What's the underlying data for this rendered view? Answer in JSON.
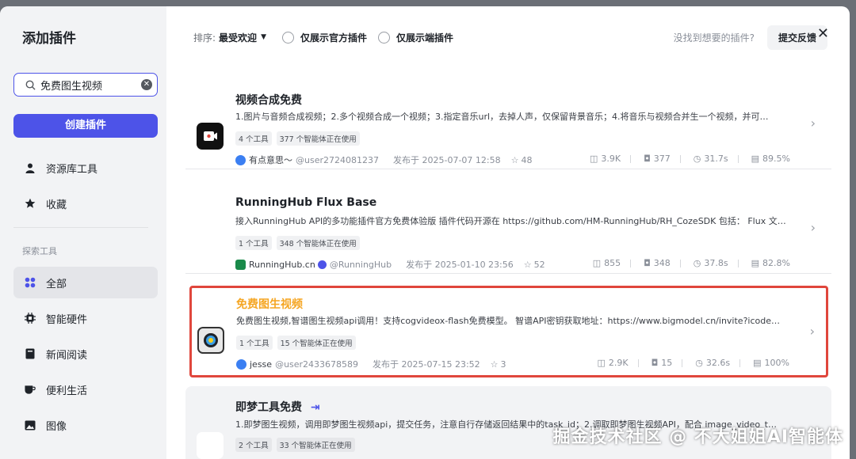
{
  "sidebar": {
    "title": "添加插件",
    "search_value": "免费图生视频",
    "create_label": "创建插件",
    "top_items": [
      {
        "label": "资源库工具",
        "icon": "user-icon"
      },
      {
        "label": "收藏",
        "icon": "star-icon"
      }
    ],
    "section_label": "探索工具",
    "categories": [
      {
        "label": "全部",
        "icon": "grid-icon",
        "active": true
      },
      {
        "label": "智能硬件",
        "icon": "chip-icon"
      },
      {
        "label": "新闻阅读",
        "icon": "book-icon"
      },
      {
        "label": "便利生活",
        "icon": "cup-icon"
      },
      {
        "label": "图像",
        "icon": "image-icon"
      }
    ]
  },
  "topbar": {
    "sort_label": "排序:",
    "sort_value": "最受欢迎",
    "filter_official": "仅展示官方插件",
    "filter_client": "仅展示端插件",
    "hint": "没找到想要的插件?",
    "feedback": "提交反馈"
  },
  "plugins": [
    {
      "title": "视频合成免费",
      "desc": "1.图片与音频合成视频；2.多个视频合成一个视频；3.指定音乐url，去掉人声，仅保留背景音乐；4.将音乐与视频合并生一个视频，并可…",
      "tools": "4 个工具",
      "usage": "377 个智能体正在使用",
      "author": "有点意思～",
      "handle": "@user2724081237",
      "published": "发布于 2025-07-07 12:58",
      "stars": "48",
      "calls": "3.9K",
      "bots": "377",
      "latency": "31.7s",
      "success": "89.5%"
    },
    {
      "title": "RunningHub Flux Base",
      "desc": "接入RunningHub API的多功能插件官方免费体验版 插件代码开源在 https://github.com/HM-RunningHub/RH_CozeSDK 包括： Flux 文…",
      "tools": "1 个工具",
      "usage": "348 个智能体正在使用",
      "author": "RunningHub.cn",
      "handle": "@RunningHub",
      "published": "发布于 2025-01-10 23:56",
      "stars": "52",
      "calls": "855",
      "bots": "348",
      "latency": "37.8s",
      "success": "82.8%"
    },
    {
      "title": "免费图生视频",
      "desc": "免费图生视频,智谱图生视频api调用！支持cogvideox-flash免费模型。 智谱API密钥获取地址：https://www.bigmodel.cn/invite?icode…",
      "tools": "1 个工具",
      "usage": "15 个智能体正在使用",
      "author": "jesse",
      "handle": "@user2433678589",
      "published": "发布于 2025-07-15 23:52",
      "stars": "3",
      "calls": "2.9K",
      "bots": "15",
      "latency": "32.6s",
      "success": "100%"
    },
    {
      "title": "即梦工具免费",
      "desc": "1.即梦图生视频，调用即梦图生视频api，提交任务，注意自行存储返回结果中的task_id；2.调取即梦图生视频API，配合 image_video_t…",
      "tools": "2 个工具",
      "usage": "33 个智能体正在使用"
    }
  ],
  "watermark": "掘金技术社区 @ 不大姐姐AI智能体",
  "colors": {
    "accent": "#4d53e8",
    "highlight_border": "#e0463c",
    "title_highlight": "#f5a623"
  }
}
